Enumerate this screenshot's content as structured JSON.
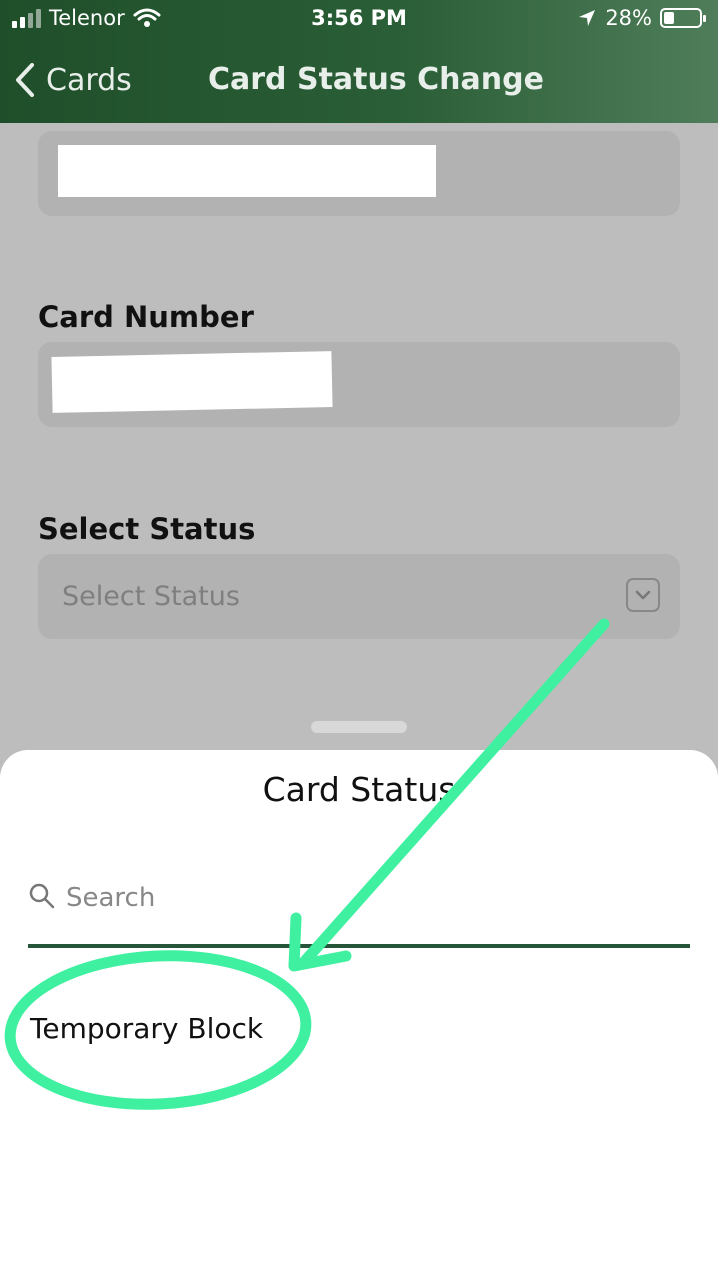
{
  "status_bar": {
    "carrier": "Telenor",
    "time": "3:56 PM",
    "battery": "28%",
    "battery_level": 0.28
  },
  "nav": {
    "back_label": "Cards",
    "title": "Card Status Change"
  },
  "form": {
    "card_number_label": "Card Number",
    "select_status_label": "Select Status",
    "select_status_placeholder": "Select Status"
  },
  "sheet": {
    "title": "Card Status",
    "search_placeholder": "Search",
    "options": [
      "Temporary Block"
    ]
  },
  "annotation": {
    "color": "#3ef0a0",
    "shapes": [
      "arrow",
      "ellipse"
    ]
  }
}
